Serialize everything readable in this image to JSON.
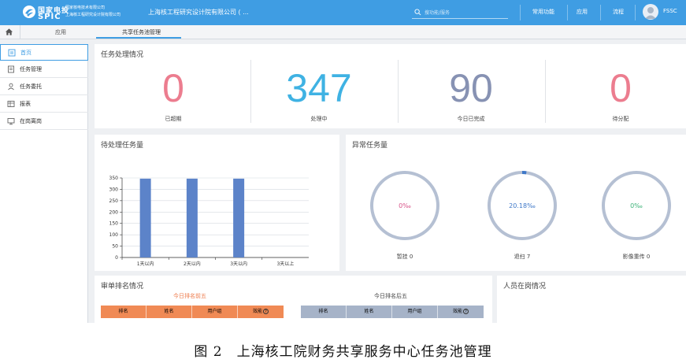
{
  "topbar": {
    "logo_cn": "国家电投",
    "logo_en": "SPIC",
    "logo_sub1": "国家核电技术有限公司",
    "logo_sub2": "上海核工程研究设计院有限公司",
    "company": "上海核工程研究设计院有限公司 ( ...",
    "search_placeholder": "搜功能/服务",
    "links": [
      "常用功能",
      "应用",
      "流程"
    ],
    "user": "FSSC"
  },
  "tabs": {
    "app": "应用",
    "task_pool": "共享任务池管理"
  },
  "sidebar": {
    "items": [
      {
        "label": "首页",
        "icon": "home-page-icon",
        "active": true
      },
      {
        "label": "任务管理",
        "icon": "task-icon",
        "active": false
      },
      {
        "label": "任务委托",
        "icon": "delegate-icon",
        "active": false
      },
      {
        "label": "报表",
        "icon": "report-icon",
        "active": false
      },
      {
        "label": "在岗离岗",
        "icon": "monitor-icon",
        "active": false
      }
    ]
  },
  "task_status": {
    "title": "任务处理情况",
    "stats": [
      {
        "value": "0",
        "label": "已超期",
        "color": "#ec7d8f"
      },
      {
        "value": "347",
        "label": "处理中",
        "color": "#3fb2e3"
      },
      {
        "value": "90",
        "label": "今日已完成",
        "color": "#8792b3"
      },
      {
        "value": "0",
        "label": "待分配",
        "color": "#ec7d8f"
      }
    ]
  },
  "pending": {
    "title": "待处理任务量"
  },
  "chart_data": {
    "type": "bar",
    "categories": [
      "1天以内",
      "2天以内",
      "3天以内",
      "3天以上"
    ],
    "values": [
      347,
      347,
      347,
      0
    ],
    "ylim": [
      0,
      350
    ],
    "yticks": [
      0,
      50,
      100,
      150,
      200,
      250,
      300,
      350
    ],
    "grid": true,
    "color": "#5c83c9"
  },
  "abnormal": {
    "title": "异常任务量",
    "donuts": [
      {
        "percent_text": "0‰",
        "label": "暂挂 0",
        "text_color": "#d8558a",
        "fraction": 0
      },
      {
        "percent_text": "20.18‰",
        "label": "退扫 7",
        "text_color": "#3f78c8",
        "fraction": 0.02018
      },
      {
        "percent_text": "0‰",
        "label": "影像重传 0",
        "text_color": "#3fb47a",
        "fraction": 0
      }
    ]
  },
  "ranking": {
    "title": "审单排名情况",
    "top_title": "今日排名前五",
    "bottom_title": "今日排名后五",
    "columns": [
      "排名",
      "姓名",
      "用户组",
      "效能"
    ],
    "help_mark": "?"
  },
  "staff": {
    "title": "人员在岗情况"
  },
  "caption": "图 2　上海核工院财务共享服务中心任务池管理"
}
